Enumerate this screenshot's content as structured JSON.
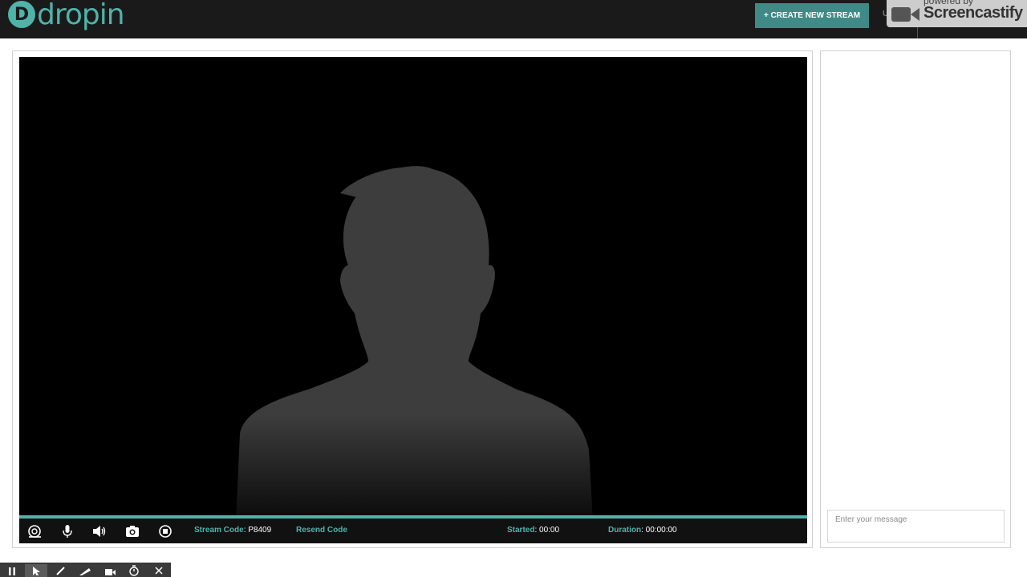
{
  "header": {
    "logo_mark": "D",
    "logo_text": "dropin",
    "create_button": "+ CREATE NEW STREAM",
    "user_menu_partial": "Use"
  },
  "watermark": {
    "powered_by": "powered by",
    "brand": "Screencastify"
  },
  "video": {
    "controls": [
      {
        "name": "screen-share",
        "icon": "screen-share-icon"
      },
      {
        "name": "microphone",
        "icon": "microphone-icon"
      },
      {
        "name": "speaker",
        "icon": "speaker-icon"
      },
      {
        "name": "camera",
        "icon": "camera-icon"
      },
      {
        "name": "stop",
        "icon": "stop-icon"
      }
    ],
    "stream_code_label": "Stream Code",
    "stream_code_value": ": P8409",
    "resend_label": "Resend Code",
    "started_label": "Started",
    "started_value": ": 00:00",
    "duration_label": "Duration",
    "duration_value": ": 00:00:00"
  },
  "chat": {
    "placeholder": "Enter your message"
  },
  "recorder_toolbar": {
    "buttons": [
      "pause-icon",
      "cursor-icon",
      "pen-icon",
      "highlighter-icon",
      "webcam-icon",
      "timer-icon",
      "close-icon"
    ]
  },
  "colors": {
    "accent": "#4fb3a9",
    "button": "#3f8a86",
    "topbar": "#1a1a1a"
  }
}
